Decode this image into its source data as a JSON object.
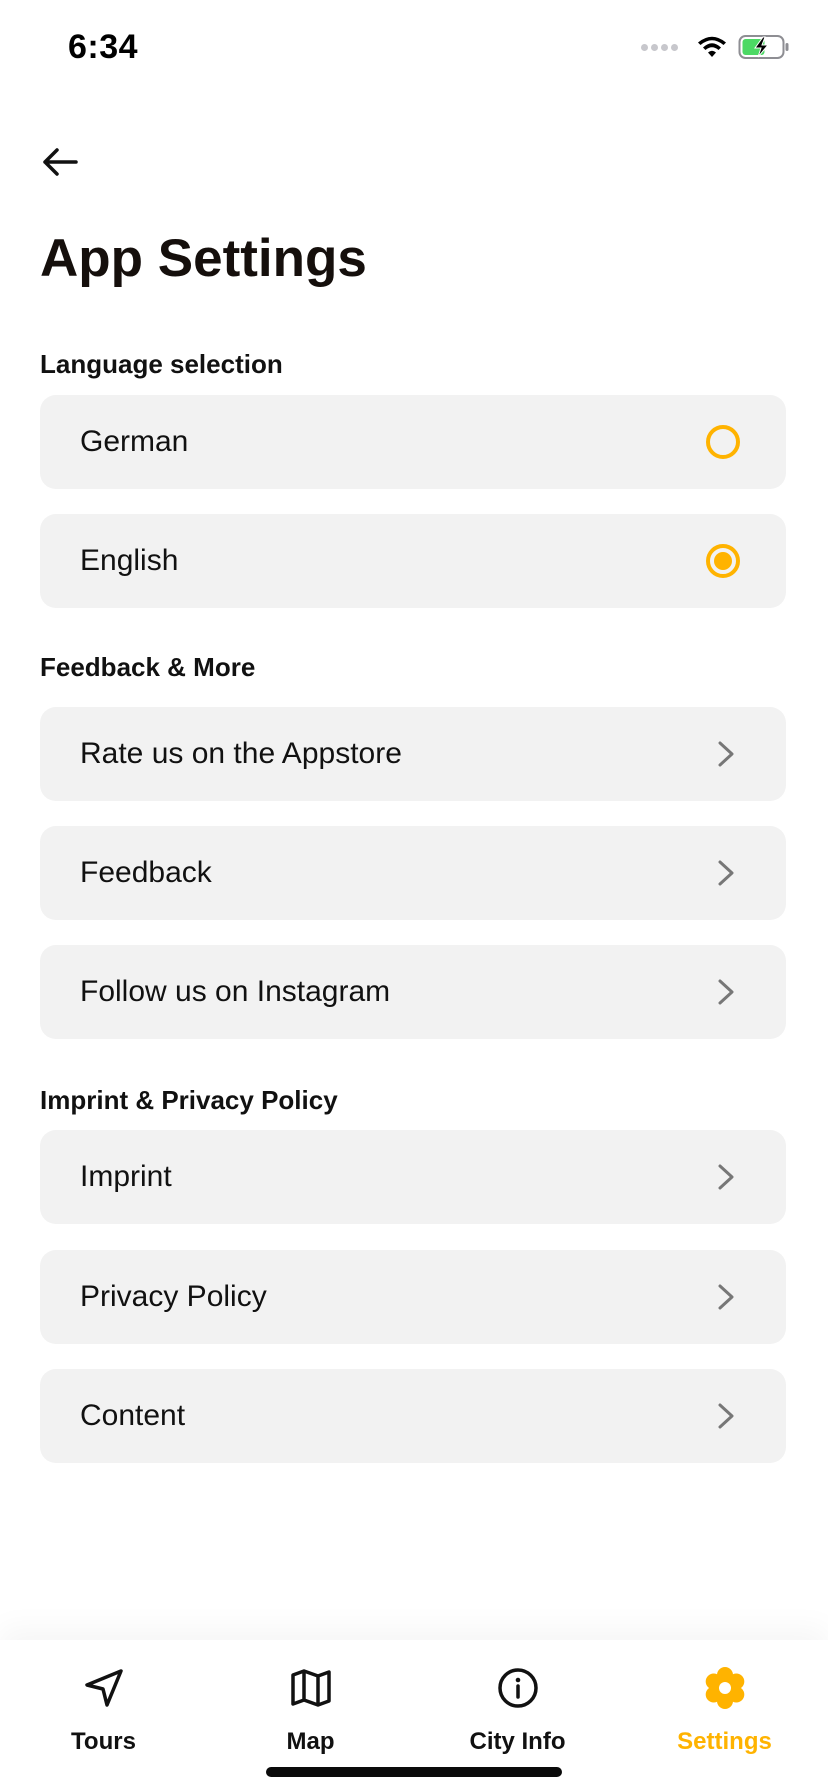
{
  "status_bar": {
    "time": "6:34"
  },
  "header": {
    "title": "App Settings"
  },
  "sections": {
    "language": {
      "title": "Language selection",
      "options": [
        {
          "label": "German",
          "selected": false
        },
        {
          "label": "English",
          "selected": true
        }
      ]
    },
    "feedback": {
      "title": "Feedback & More",
      "items": [
        {
          "label": "Rate us on the Appstore"
        },
        {
          "label": "Feedback"
        },
        {
          "label": "Follow us on Instagram"
        }
      ]
    },
    "legal": {
      "title": "Imprint & Privacy Policy",
      "items": [
        {
          "label": "Imprint"
        },
        {
          "label": "Privacy Policy"
        },
        {
          "label": "Content"
        }
      ]
    }
  },
  "tab_bar": {
    "tabs": [
      {
        "label": "Tours",
        "icon": "navigation-arrow-icon",
        "active": false
      },
      {
        "label": "Map",
        "icon": "map-icon",
        "active": false
      },
      {
        "label": "City Info",
        "icon": "info-icon",
        "active": false
      },
      {
        "label": "Settings",
        "icon": "gear-icon",
        "active": true
      }
    ]
  },
  "colors": {
    "accent": "#ffb300",
    "row_background": "#f2f2f2",
    "battery_fill": "#4cd964"
  }
}
